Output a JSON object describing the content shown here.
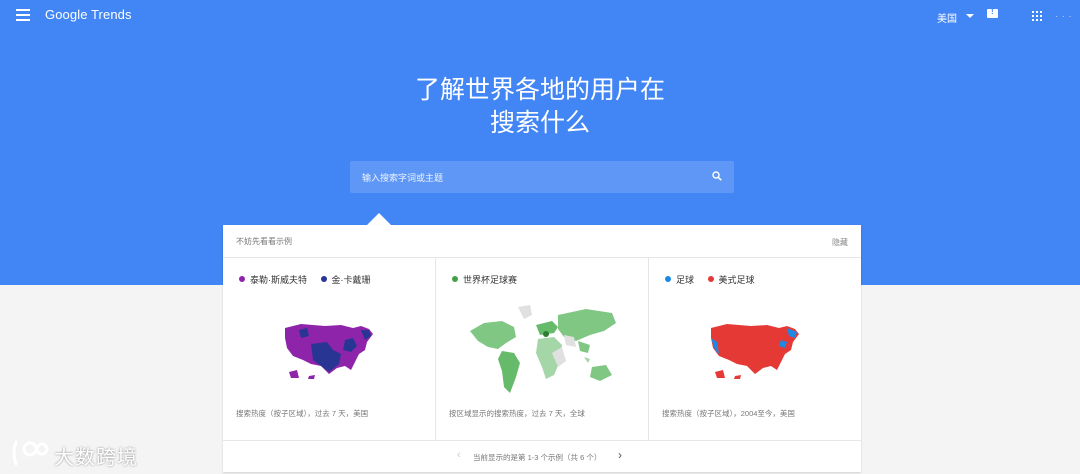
{
  "header": {
    "logo": "Google Trends",
    "region": "美国",
    "avatar": "· · ·"
  },
  "hero": {
    "headline_line1": "了解世界各地的用户在",
    "headline_line2": "搜索什么"
  },
  "search": {
    "placeholder": "输入搜索字词或主题"
  },
  "examples": {
    "title": "不妨先看看示例",
    "hide": "隐藏",
    "cards": [
      {
        "terms": [
          {
            "label": "泰勒·斯威夫特",
            "color": "#8e24aa"
          },
          {
            "label": "金·卡戴珊",
            "color": "#283593"
          }
        ],
        "caption": "搜索热度（按子区域），过去 7 天，美国"
      },
      {
        "terms": [
          {
            "label": "世界杯足球赛",
            "color": "#43a047"
          }
        ],
        "caption": "按区域显示的搜索热度，过去 7 天，全球"
      },
      {
        "terms": [
          {
            "label": "足球",
            "color": "#1e88e5"
          },
          {
            "label": "美式足球",
            "color": "#e53935"
          }
        ],
        "caption": "搜索热度（按子区域），2004至今，美国"
      }
    ],
    "pager": {
      "text": "当前显示的是第 1-3 个示例（共 6 个）",
      "prev": "‹",
      "next": "›"
    }
  },
  "watermark": {
    "text": "大数跨境"
  },
  "colors": {
    "brand_blue": "#4285f4",
    "search_bg": "#5e97f6"
  }
}
